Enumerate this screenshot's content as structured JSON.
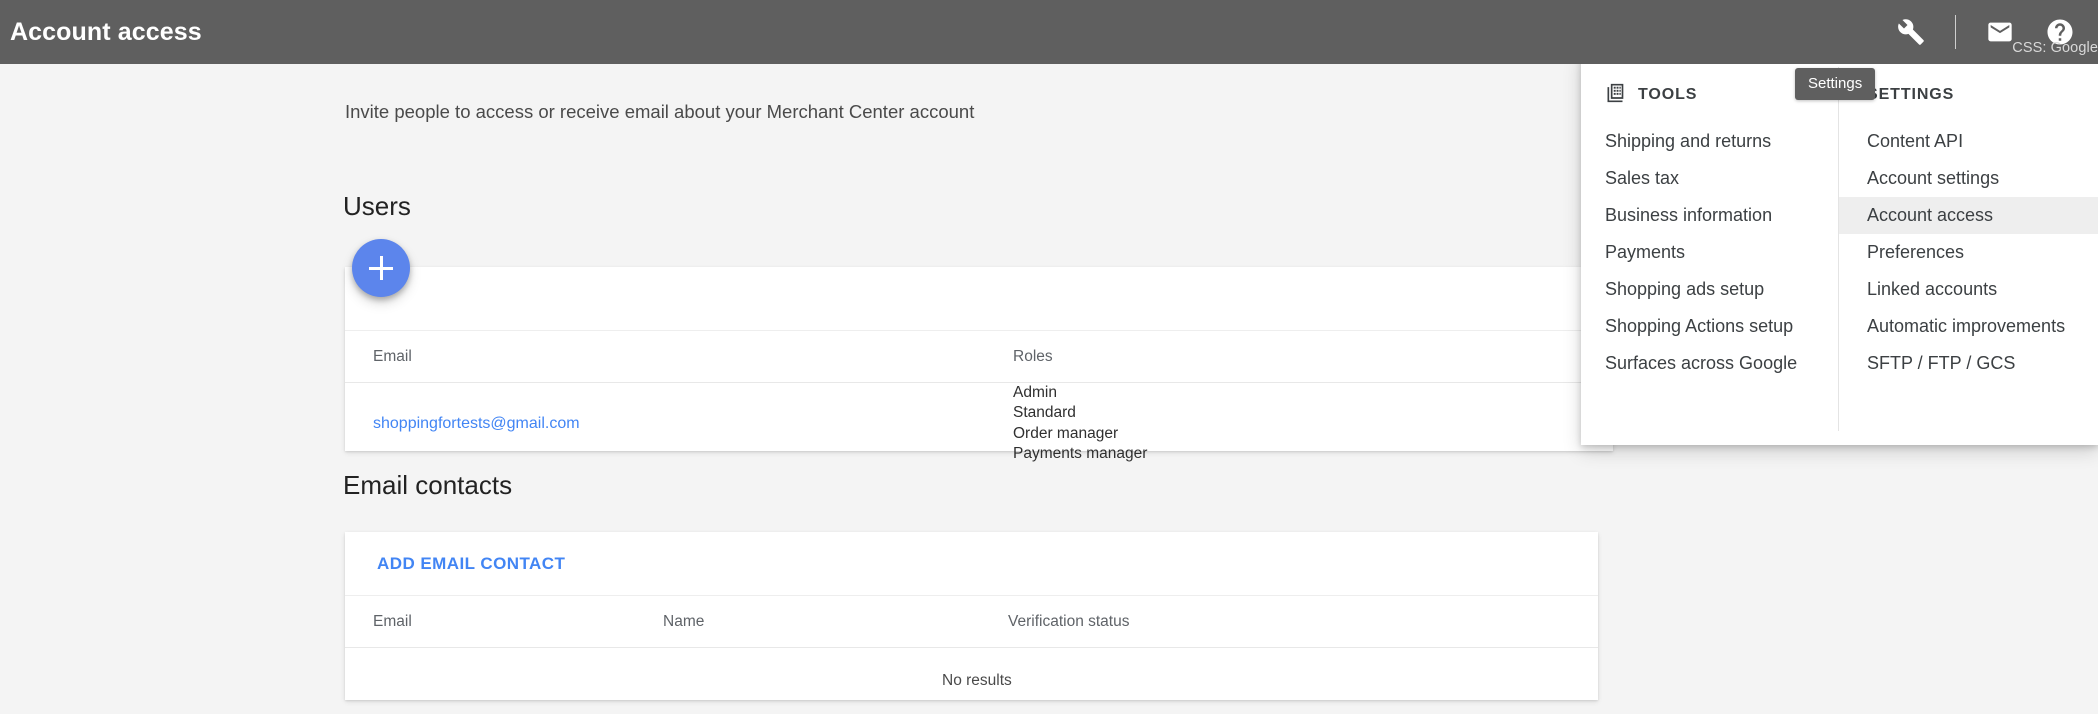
{
  "appbar": {
    "title": "Account access",
    "account_label": "CSS: Google",
    "icons": {
      "tools": "wrench-icon",
      "mail": "mail-icon",
      "help": "help-icon"
    }
  },
  "tooltip": {
    "text": "Settings"
  },
  "menu": {
    "tools": {
      "header": "TOOLS",
      "header_icon": "grid-icon",
      "items": [
        {
          "label": "Shipping and returns",
          "active": false
        },
        {
          "label": "Sales tax",
          "active": false
        },
        {
          "label": "Business information",
          "active": false
        },
        {
          "label": "Payments",
          "active": false
        },
        {
          "label": "Shopping ads setup",
          "active": false
        },
        {
          "label": "Shopping Actions setup",
          "active": false
        },
        {
          "label": "Surfaces across Google",
          "active": false
        }
      ]
    },
    "settings": {
      "header": "SETTINGS",
      "items": [
        {
          "label": "Content API",
          "active": false
        },
        {
          "label": "Account settings",
          "active": false
        },
        {
          "label": "Account access",
          "active": true
        },
        {
          "label": "Preferences",
          "active": false
        },
        {
          "label": "Linked accounts",
          "active": false
        },
        {
          "label": "Automatic improvements",
          "active": false
        },
        {
          "label": "SFTP / FTP / GCS",
          "active": false
        }
      ]
    }
  },
  "main": {
    "intro": "Invite people to access or receive email about your Merchant Center account",
    "users": {
      "title": "Users",
      "add_button_label": "+",
      "columns": {
        "email": "Email",
        "roles": "Roles"
      },
      "rows": [
        {
          "email": "shoppingfortests@gmail.com",
          "roles": [
            "Admin",
            "Standard",
            "Order manager",
            "Payments manager"
          ]
        }
      ]
    },
    "contacts": {
      "title": "Email contacts",
      "add_button_label": "ADD EMAIL CONTACT",
      "columns": {
        "email": "Email",
        "name": "Name",
        "status": "Verification status"
      },
      "empty_text": "No results"
    }
  },
  "colors": {
    "appbar_bg": "#5f5f5f",
    "page_bg": "#f4f4f4",
    "accent_blue": "#4285f4",
    "fab_blue": "#5c85ec",
    "menu_active_bg": "#eeeeee"
  }
}
